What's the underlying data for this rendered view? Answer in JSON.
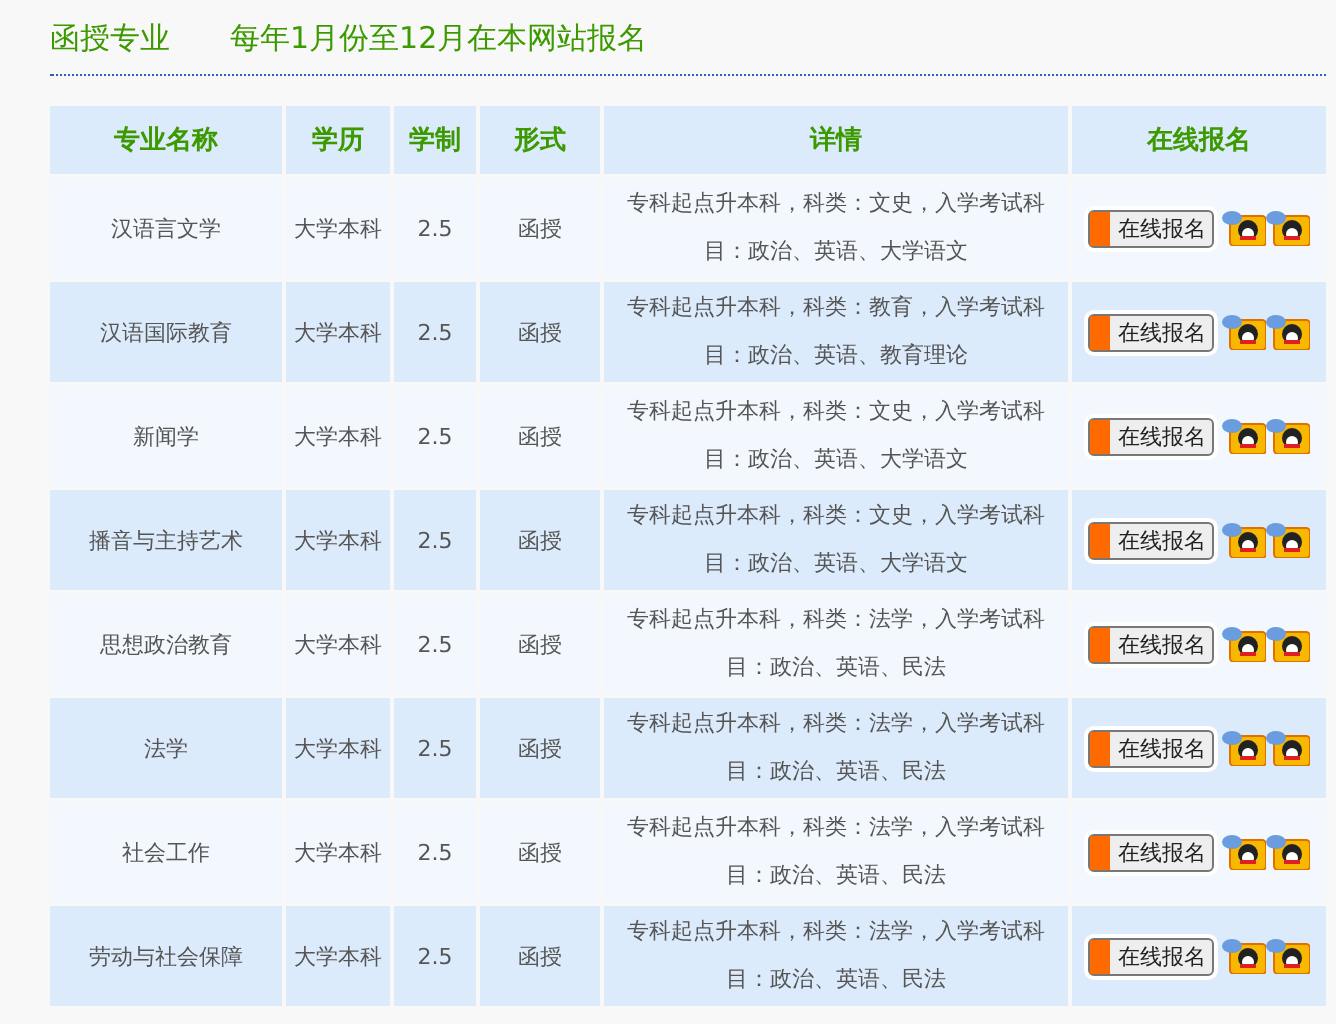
{
  "header": {
    "title": "函授专业",
    "note": "每年1月份至12月在本网站报名"
  },
  "table": {
    "columns": [
      "专业名称",
      "学历",
      "学制",
      "形式",
      "详情",
      "在线报名"
    ],
    "rows": [
      {
        "name": "汉语言文学",
        "level": "大学本科",
        "years": "2.5",
        "form": "函授",
        "details": "专科起点升本科，科类：文史，入学考试科目：政治、英语、大学语文",
        "button": "在线报名"
      },
      {
        "name": "汉语国际教育",
        "level": "大学本科",
        "years": "2.5",
        "form": "函授",
        "details": "专科起点升本科，科类：教育，入学考试科目：政治、英语、教育理论",
        "button": "在线报名"
      },
      {
        "name": "新闻学",
        "level": "大学本科",
        "years": "2.5",
        "form": "函授",
        "details": "专科起点升本科，科类：文史，入学考试科目：政治、英语、大学语文",
        "button": "在线报名"
      },
      {
        "name": "播音与主持艺术",
        "level": "大学本科",
        "years": "2.5",
        "form": "函授",
        "details": "专科起点升本科，科类：文史，入学考试科目：政治、英语、大学语文",
        "button": "在线报名"
      },
      {
        "name": "思想政治教育",
        "level": "大学本科",
        "years": "2.5",
        "form": "函授",
        "details": "专科起点升本科，科类：法学，入学考试科目：政治、英语、民法",
        "button": "在线报名"
      },
      {
        "name": "法学",
        "level": "大学本科",
        "years": "2.5",
        "form": "函授",
        "details": "专科起点升本科，科类：法学，入学考试科目：政治、英语、民法",
        "button": "在线报名"
      },
      {
        "name": "社会工作",
        "level": "大学本科",
        "years": "2.5",
        "form": "函授",
        "details": "专科起点升本科，科类：法学，入学考试科目：政治、英语、民法",
        "button": "在线报名"
      },
      {
        "name": "劳动与社会保障",
        "level": "大学本科",
        "years": "2.5",
        "form": "函授",
        "details": "专科起点升本科，科类：法学，入学考试科目：政治、英语、民法",
        "button": "在线报名"
      }
    ]
  }
}
